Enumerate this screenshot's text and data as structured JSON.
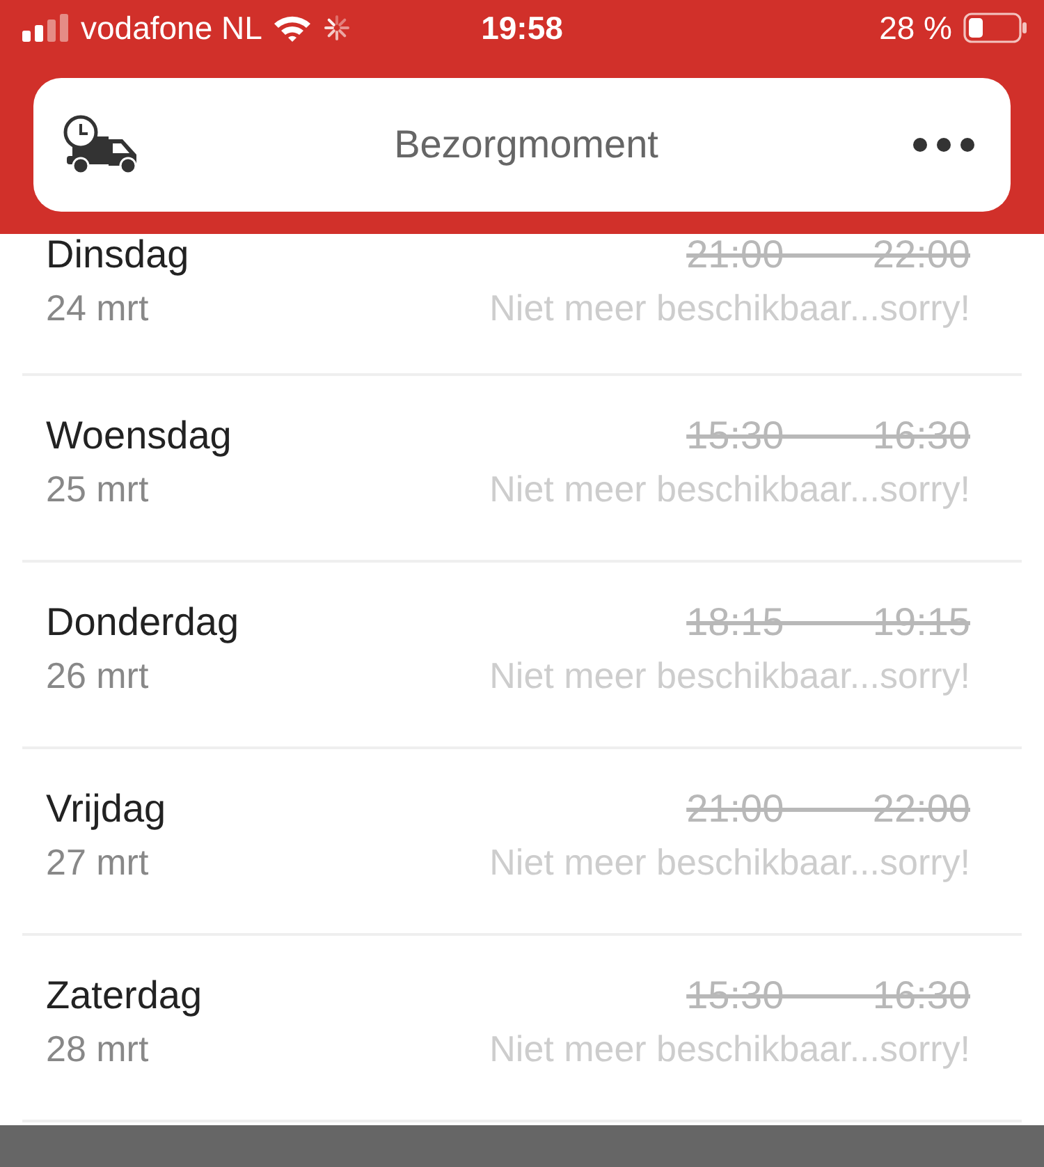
{
  "status_bar": {
    "carrier": "vodafone NL",
    "time": "19:58",
    "battery": "28 %"
  },
  "header": {
    "title": "Bezorgmoment"
  },
  "slots": [
    {
      "day": "Dinsdag",
      "date": "24 mrt",
      "start": "21:00",
      "end": "22:00",
      "available": false,
      "note": "Niet meer beschikbaar...sorry!"
    },
    {
      "day": "Woensdag",
      "date": "25 mrt",
      "start": "15:30",
      "end": "16:30",
      "available": false,
      "note": "Niet meer beschikbaar...sorry!"
    },
    {
      "day": "Donderdag",
      "date": "26 mrt",
      "start": "18:15",
      "end": "19:15",
      "available": false,
      "note": "Niet meer beschikbaar...sorry!"
    },
    {
      "day": "Vrijdag",
      "date": "27 mrt",
      "start": "21:00",
      "end": "22:00",
      "available": false,
      "note": "Niet meer beschikbaar...sorry!"
    },
    {
      "day": "Zaterdag",
      "date": "28 mrt",
      "start": "15:30",
      "end": "16:30",
      "available": false,
      "note": "Niet meer beschikbaar...sorry!"
    }
  ]
}
